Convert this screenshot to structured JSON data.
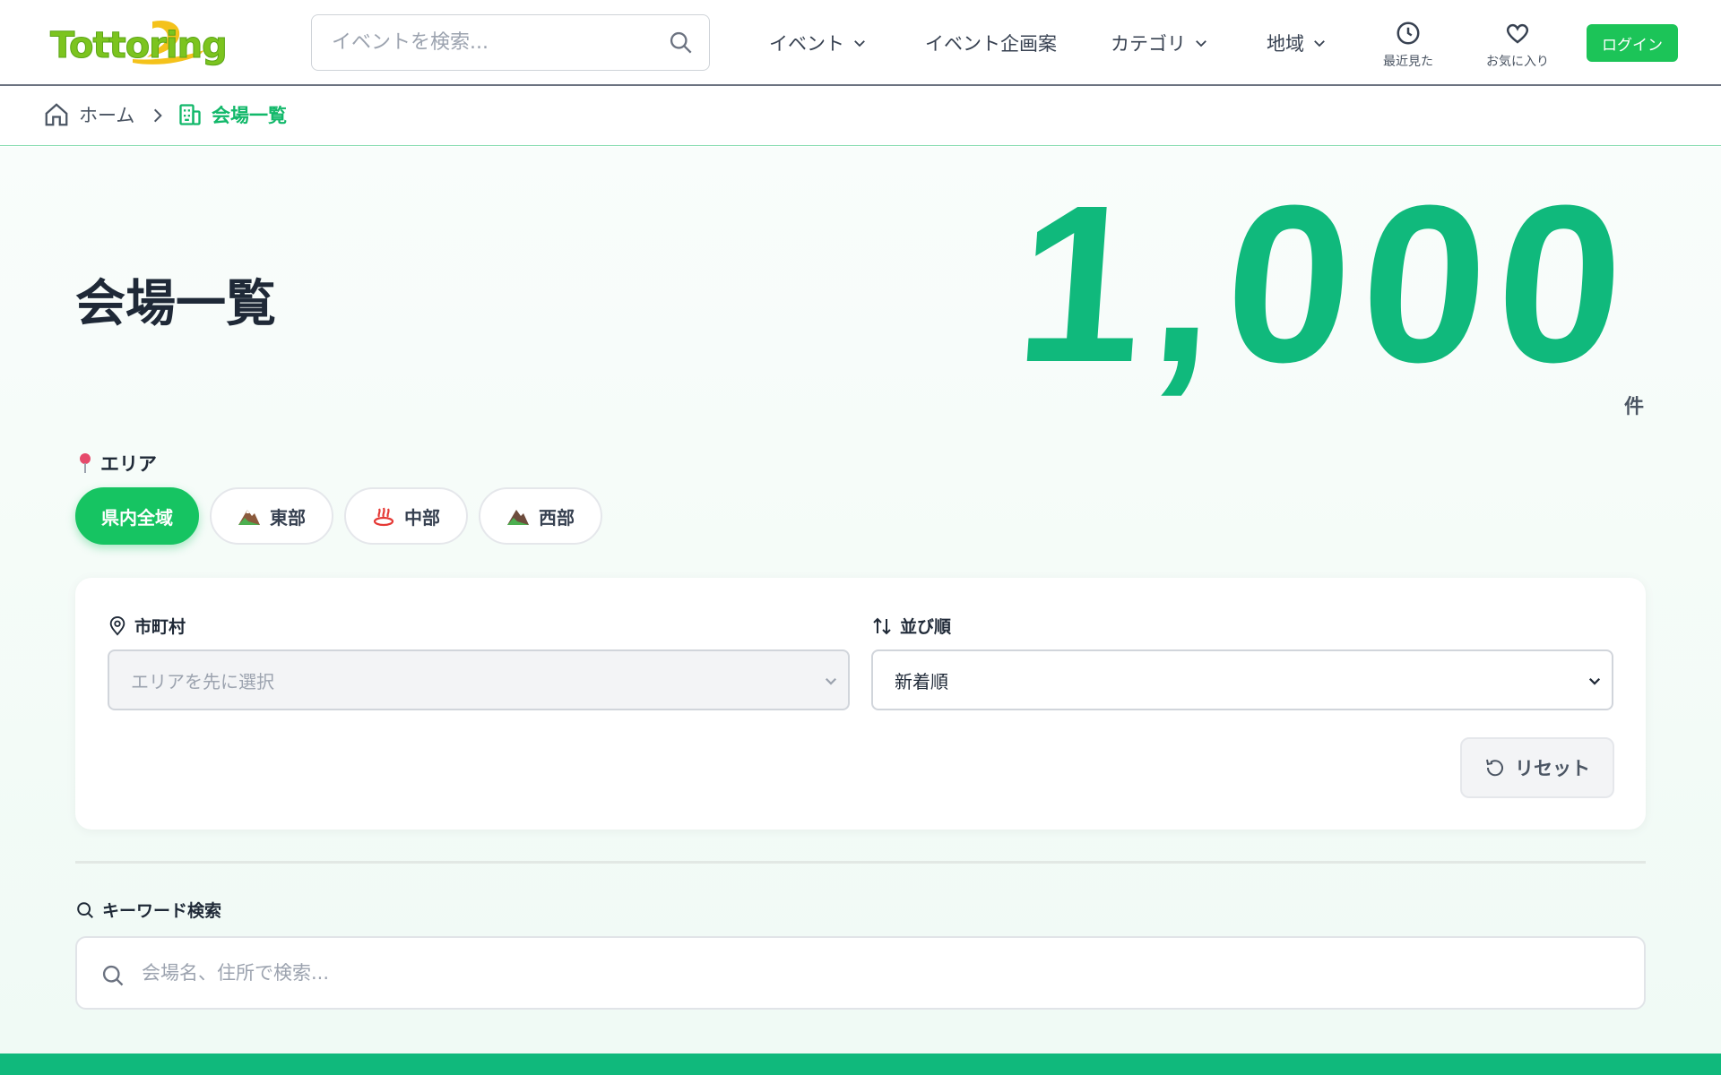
{
  "header": {
    "logo": "Tottoring",
    "search_placeholder": "イベントを検索...",
    "nav": [
      {
        "label": "イベント",
        "dropdown": true
      },
      {
        "label": "イベント企画案",
        "dropdown": false
      },
      {
        "label": "カテゴリ",
        "dropdown": true
      },
      {
        "label": "地域",
        "dropdown": true
      }
    ],
    "recent_label": "最近見た",
    "favorites_label": "お気に入り",
    "login_label": "ログイン",
    "accent_color": "#1cc458"
  },
  "breadcrumb": {
    "home": "ホーム",
    "current": "会場一覧"
  },
  "main": {
    "title": "会場一覧",
    "count": "1,000",
    "count_unit": "件",
    "area_label": "エリア",
    "areas": [
      {
        "label": "県内全域",
        "icon": "none",
        "active": true
      },
      {
        "label": "東部",
        "icon": "mountain-icon",
        "active": false
      },
      {
        "label": "中部",
        "icon": "hot-spring-icon",
        "active": false
      },
      {
        "label": "西部",
        "icon": "mountain-icon",
        "active": false
      }
    ],
    "city_label": "市町村",
    "city_placeholder": "エリアを先に選択",
    "sort_label": "並び順",
    "sort_value": "新着順",
    "reset_label": "リセット",
    "keyword_label": "キーワード検索",
    "keyword_placeholder": "会場名、住所で検索...",
    "count_color": "#10b97c"
  }
}
